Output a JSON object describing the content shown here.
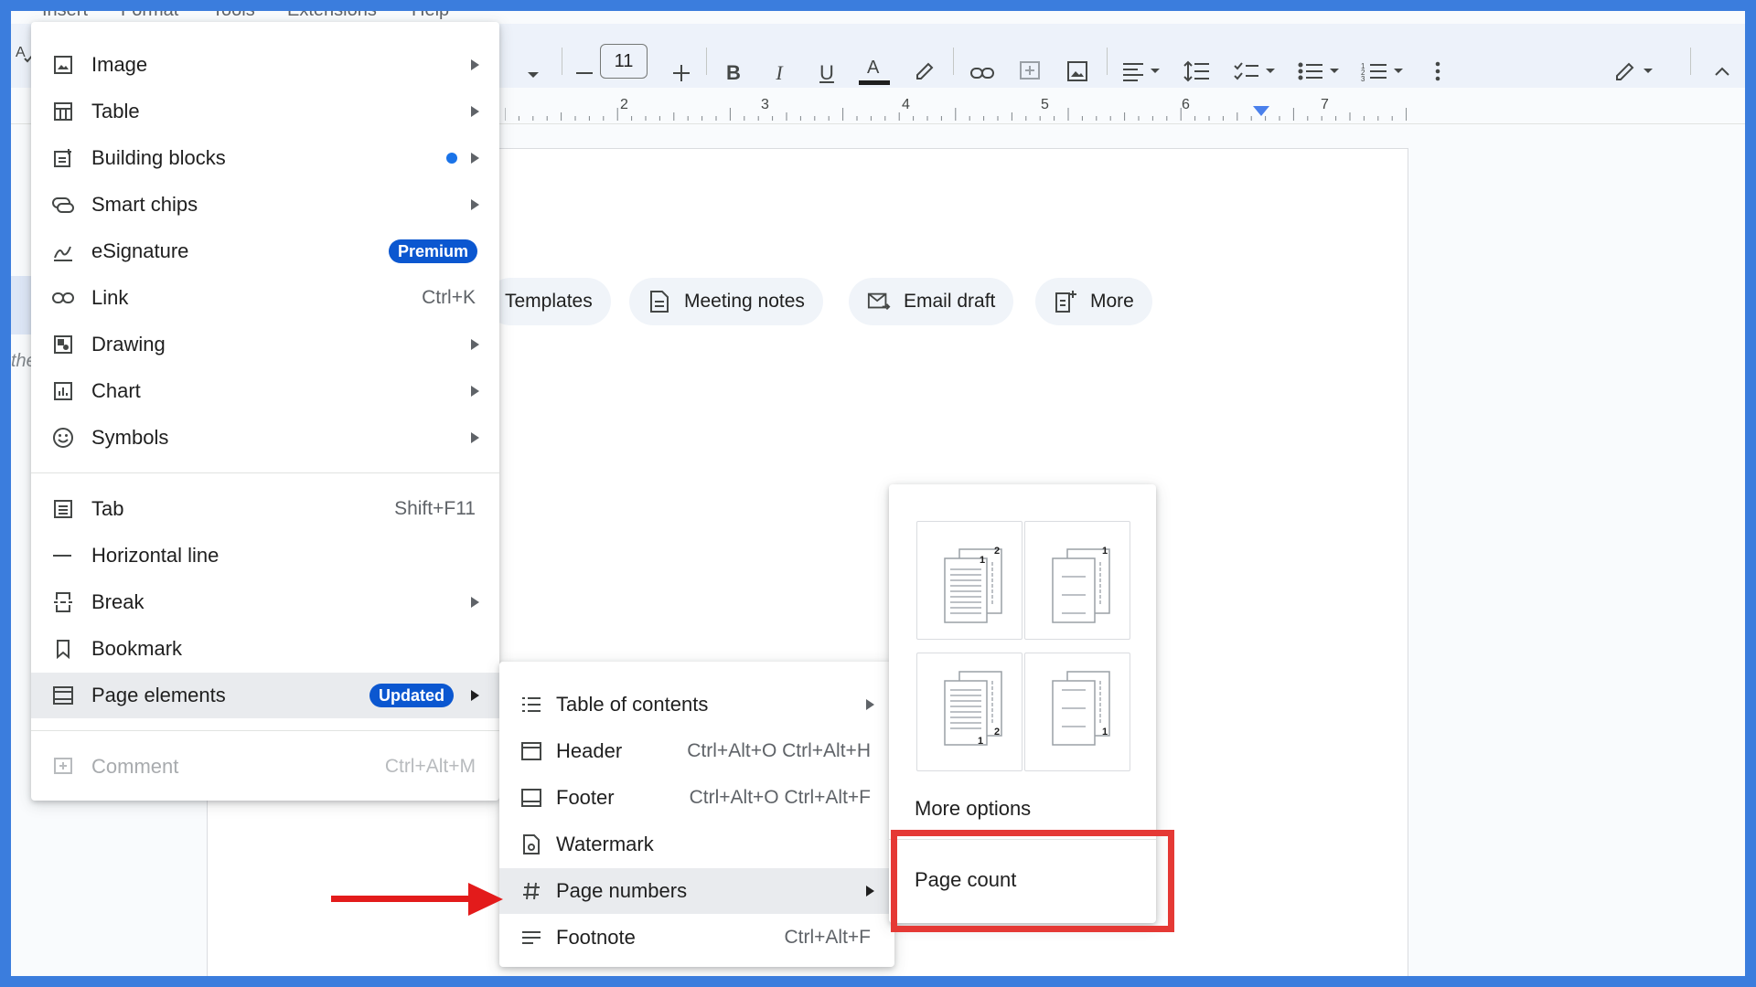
{
  "menubar": [
    "Insert",
    "Format",
    "Tools",
    "Extensions",
    "Help"
  ],
  "toolbar": {
    "font_size": "11"
  },
  "ruler": {
    "numbers": [
      "2",
      "3",
      "4",
      "5",
      "6",
      "7"
    ]
  },
  "side_text": "the",
  "chips": [
    {
      "label": "Templates",
      "icon": "templates-icon"
    },
    {
      "label": "Meeting notes",
      "icon": "document-icon"
    },
    {
      "label": "Email draft",
      "icon": "email-icon"
    },
    {
      "label": "More",
      "icon": "more-doc-icon"
    }
  ],
  "insert_menu": {
    "items": [
      {
        "label": "Image",
        "icon": "image-icon",
        "submenu": true
      },
      {
        "label": "Table",
        "icon": "table-icon",
        "submenu": true
      },
      {
        "label": "Building blocks",
        "icon": "building-blocks-icon",
        "submenu": true,
        "dot": true
      },
      {
        "label": "Smart chips",
        "icon": "smart-chips-icon",
        "submenu": true
      },
      {
        "label": "eSignature",
        "icon": "esignature-icon",
        "badge": "Premium"
      },
      {
        "label": "Link",
        "icon": "link-icon",
        "shortcut": "Ctrl+K"
      },
      {
        "label": "Drawing",
        "icon": "drawing-icon",
        "submenu": true
      },
      {
        "label": "Chart",
        "icon": "chart-icon",
        "submenu": true
      },
      {
        "label": "Symbols",
        "icon": "emoji-icon",
        "submenu": true
      },
      {
        "label": "Tab",
        "icon": "tab-icon",
        "shortcut": "Shift+F11"
      },
      {
        "label": "Horizontal line",
        "icon": "horizontal-line-icon"
      },
      {
        "label": "Break",
        "icon": "break-icon",
        "submenu": true
      },
      {
        "label": "Bookmark",
        "icon": "bookmark-icon"
      },
      {
        "label": "Page elements",
        "icon": "page-elements-icon",
        "submenu": true,
        "badge": "Updated"
      },
      {
        "label": "Comment",
        "icon": "comment-icon",
        "shortcut": "Ctrl+Alt+M",
        "disabled": true
      }
    ]
  },
  "page_elements_menu": {
    "items": [
      {
        "label": "Table of contents",
        "icon": "toc-icon",
        "submenu": true
      },
      {
        "label": "Header",
        "icon": "header-icon",
        "shortcut": "Ctrl+Alt+O Ctrl+Alt+H"
      },
      {
        "label": "Footer",
        "icon": "footer-icon",
        "shortcut": "Ctrl+Alt+O Ctrl+Alt+F"
      },
      {
        "label": "Watermark",
        "icon": "watermark-icon"
      },
      {
        "label": "Page numbers",
        "icon": "hash-icon",
        "submenu": true
      },
      {
        "label": "Footnote",
        "icon": "footnote-icon",
        "shortcut": "Ctrl+Alt+F"
      }
    ]
  },
  "page_numbers_menu": {
    "more_options": "More options",
    "page_count": "Page count",
    "thumbs": [
      {
        "digits": [
          "1",
          "2"
        ]
      },
      {
        "digits": [
          "1"
        ]
      },
      {
        "digits": [
          "1",
          "2"
        ]
      },
      {
        "digits": [
          "1"
        ]
      }
    ]
  },
  "colors": {
    "frame_border": "#3b7ddd",
    "highlight": "#e53935",
    "badge": "#0b57d0"
  }
}
